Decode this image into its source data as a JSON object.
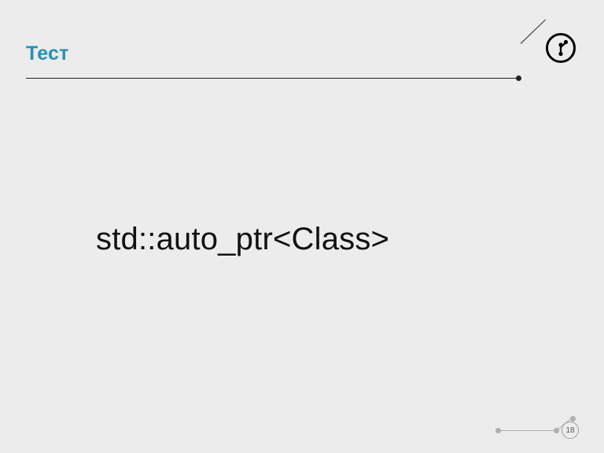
{
  "header": {
    "title": "Тест"
  },
  "content": {
    "body_text": "std::auto_ptr<Class>"
  },
  "footer": {
    "page_number": "18"
  }
}
